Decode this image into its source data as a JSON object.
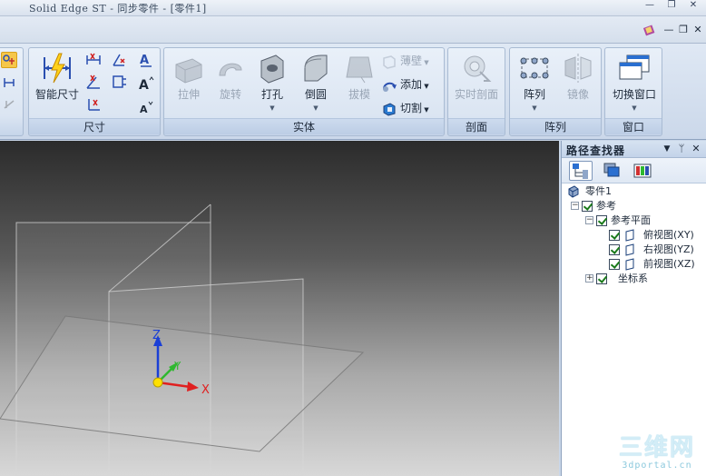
{
  "window": {
    "title": "Solid Edge ST - 同步零件 - [零件1]",
    "minimize_glyph": "—",
    "restore_glyph": "❐",
    "close_glyph": "✕"
  },
  "menubar": {
    "help_icon": "help-book-icon",
    "minimize_glyph": "—",
    "restore_glyph": "❐",
    "close_glyph": "✕"
  },
  "ribbon": {
    "dimension_group": {
      "label": "尺寸",
      "smart_dimension_label": "智能尺寸"
    },
    "solid_group": {
      "label": "实体",
      "extrude_label": "拉伸",
      "revolve_label": "旋转",
      "hole_label": "打孔",
      "round_label": "倒圆",
      "draft_label": "拔模",
      "thin_wall_label": "薄壁",
      "add_label": "添加",
      "cut_label": "切割"
    },
    "section_group": {
      "label": "剖面",
      "live_section_label": "实时剖面"
    },
    "pattern_group": {
      "label": "阵列",
      "pattern_label": "阵列",
      "mirror_label": "镜像"
    },
    "window_group": {
      "label": "窗口",
      "switch_window_label": "切换窗口"
    }
  },
  "viewport": {
    "axis_z": "Z",
    "axis_y": "Y",
    "axis_x": "X",
    "colors": {
      "z_axis": "#1a3fd6",
      "y_axis": "#2fb82f",
      "x_axis": "#e02020",
      "origin": "#ffe000"
    }
  },
  "pathfinder": {
    "title": "路径查找器",
    "dropdown_glyph": "▼",
    "pin_glyph": "ᛘ",
    "close_glyph": "✕",
    "tree": {
      "root": "零件1",
      "reference": "参考",
      "reference_planes": "参考平面",
      "plane_top": "俯视图(XY)",
      "plane_right": "右视图(YZ)",
      "plane_front": "前视图(XZ)",
      "coordinate_systems": "坐标系",
      "expanded_glyph": "−",
      "collapsed_glyph": "+"
    }
  },
  "watermark": {
    "main": "三维网",
    "sub": "3dportal.cn"
  }
}
